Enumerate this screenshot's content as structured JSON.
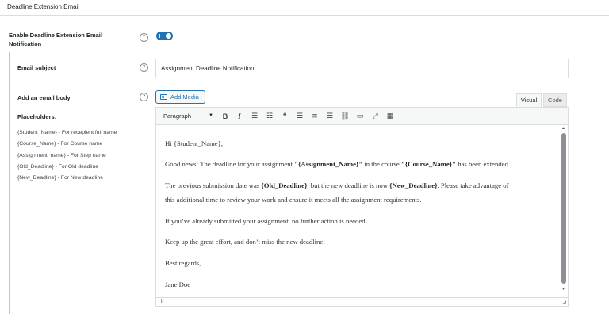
{
  "section": {
    "title": "Deadline Extension Email"
  },
  "enable": {
    "label_line1": "Enable Deadline Extension Email",
    "label_line2": "Notification",
    "help": "?",
    "enabled": true
  },
  "subject": {
    "label": "Email subject",
    "help": "?",
    "value": "Assignment Deadline Notification"
  },
  "body": {
    "label": "Add an email body",
    "help": "?",
    "add_media_label": "Add Media",
    "tabs": {
      "visual": "Visual",
      "code": "Code"
    },
    "format_select": "Paragraph",
    "status_path": "p"
  },
  "placeholders": {
    "title": "Placeholders:",
    "items": [
      "{Student_Name} - For recepient full name",
      "{Course_Name} - For Course name",
      "{Assignment_name} - For Step name",
      "{Old_Deadline} - For Old deadline",
      "{New_Deadline} - For New deadline"
    ]
  },
  "email": {
    "greeting": "Hi {Student_Name},",
    "p1": {
      "t1": "Good news! The deadline for your assignment ",
      "b1": "\"{Assignment_Name}\"",
      "t2": " in the course ",
      "b2": "\"{Course_Name}\"",
      "t3": " has been extended."
    },
    "p2": {
      "t1": "The previous submission date was ",
      "b1": "{Old_Deadline}",
      "t2": ", but the new deadline is now ",
      "b2": "{New_Deadline}",
      "t3": ". Please take advantage of",
      "line2": "this additional time to review your work and ensure it meets all the assignment requirements."
    },
    "p3": "If you’ve already submitted your assignment, no further action is needed.",
    "p4": "Keep up the great effort, and don’t miss the new deadline!",
    "closing": "Best regards,",
    "signature": "Jane Doe"
  },
  "toolbar": {
    "bold": "B",
    "italic": "I",
    "bullet_list": "☰",
    "numbered_list": "☷",
    "blockquote": "❝",
    "align_left": "☰",
    "align_center": "≡",
    "align_right": "☰",
    "link": "⛓",
    "more": "▭",
    "fullscreen": "⤢",
    "kitchen_sink": "▦"
  }
}
